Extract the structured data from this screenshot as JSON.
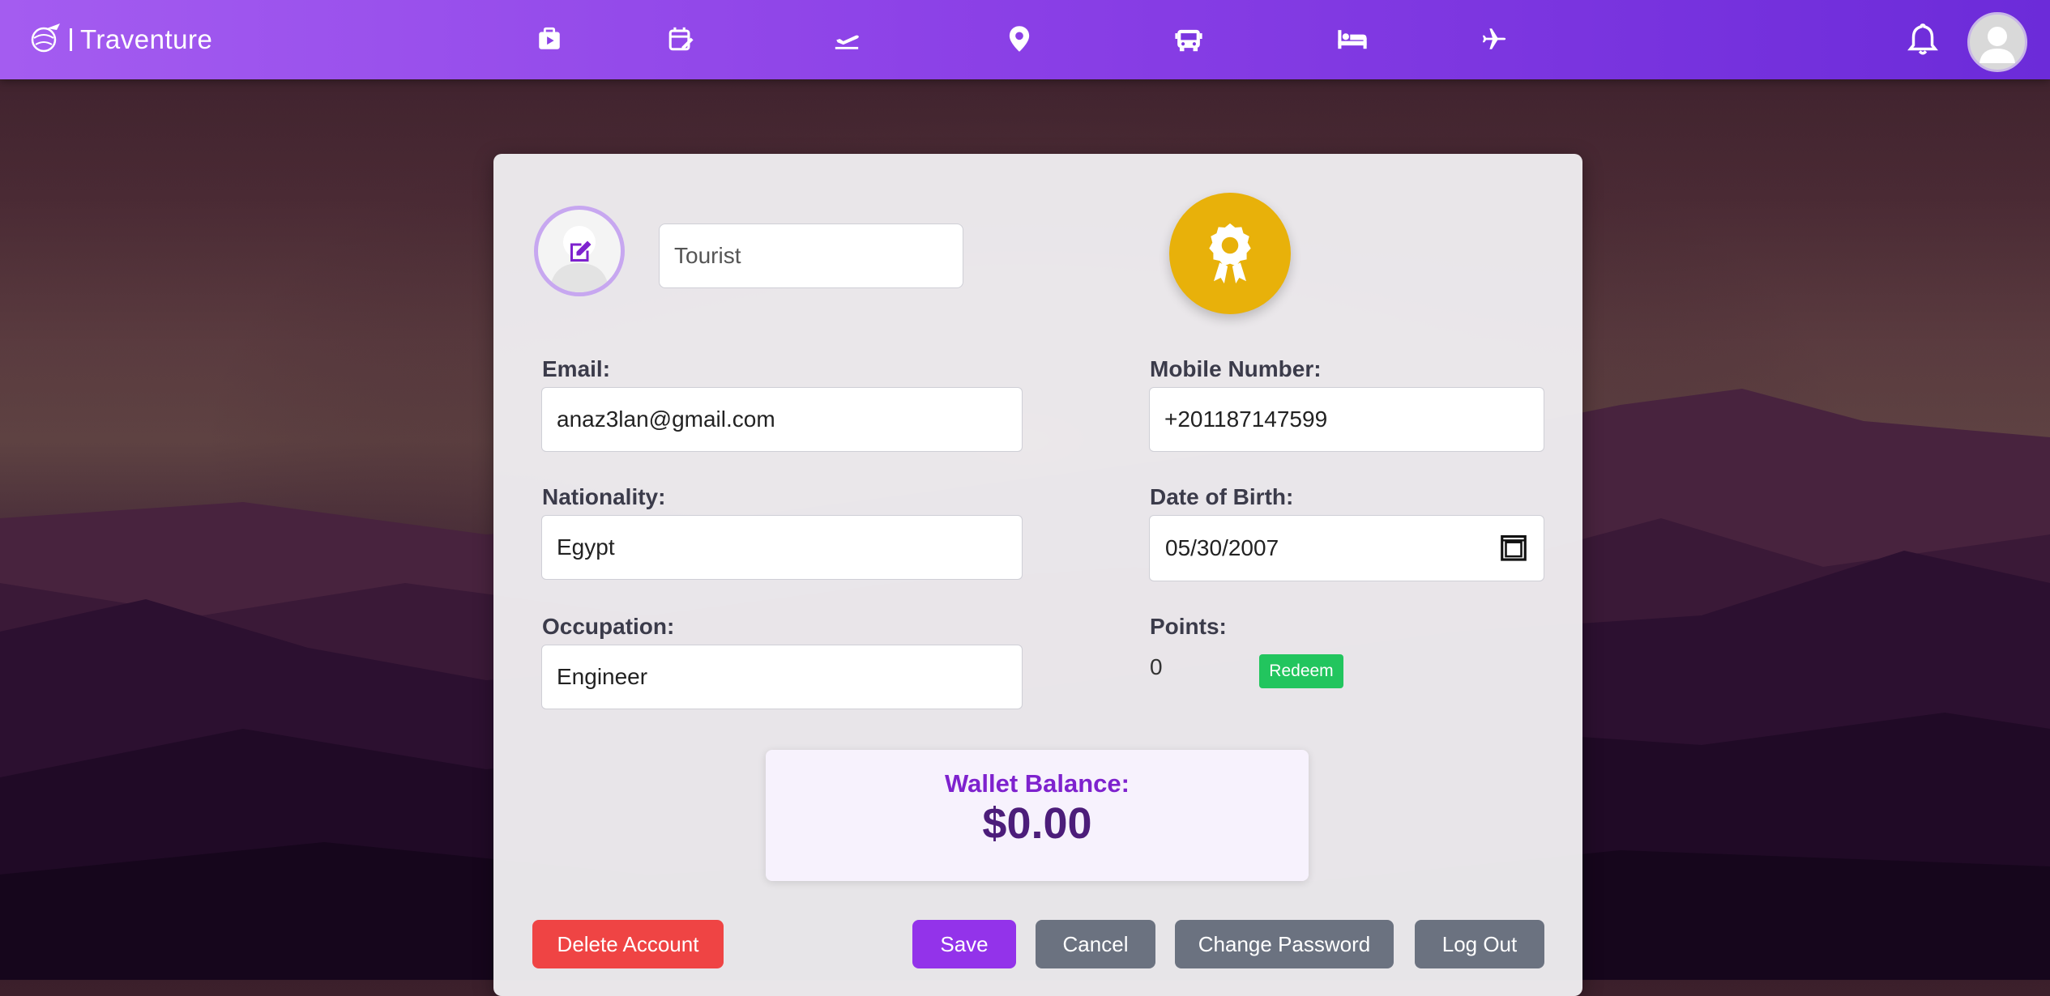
{
  "colors": {
    "nav_gradient_start": "#a45cf0",
    "nav_gradient_end": "#6c2bd9",
    "badge": "#e8b10a",
    "redeem": "#22c55e",
    "delete": "#ef4444",
    "save": "#9333ea",
    "secondary": "#6b7280",
    "wallet_text": "#7e22ce"
  },
  "nav": {
    "brand": "Traventure",
    "icons": [
      "video-icon",
      "calendar-edit-icon",
      "departure-icon",
      "map-pin-icon",
      "bus-icon",
      "bed-icon",
      "plane-icon"
    ],
    "bell_icon": "bell-icon",
    "avatar_icon": "user-avatar"
  },
  "profile": {
    "username": "Tourist",
    "badge_icon": "award-icon",
    "email_label": "Email:",
    "email": "anaz3lan@gmail.com",
    "mobile_label": "Mobile Number:",
    "mobile": "+201187147599",
    "nationality_label": "Nationality:",
    "nationality": "Egypt",
    "dob_label": "Date of Birth:",
    "dob": "05/30/2007",
    "occupation_label": "Occupation:",
    "occupation": "Engineer",
    "points_label": "Points:",
    "points": "0",
    "redeem_label": "Redeem"
  },
  "wallet": {
    "label": "Wallet Balance:",
    "amount": "$0.00"
  },
  "actions": {
    "delete": "Delete Account",
    "save": "Save",
    "cancel": "Cancel",
    "change_password": "Change Password",
    "logout": "Log Out"
  }
}
